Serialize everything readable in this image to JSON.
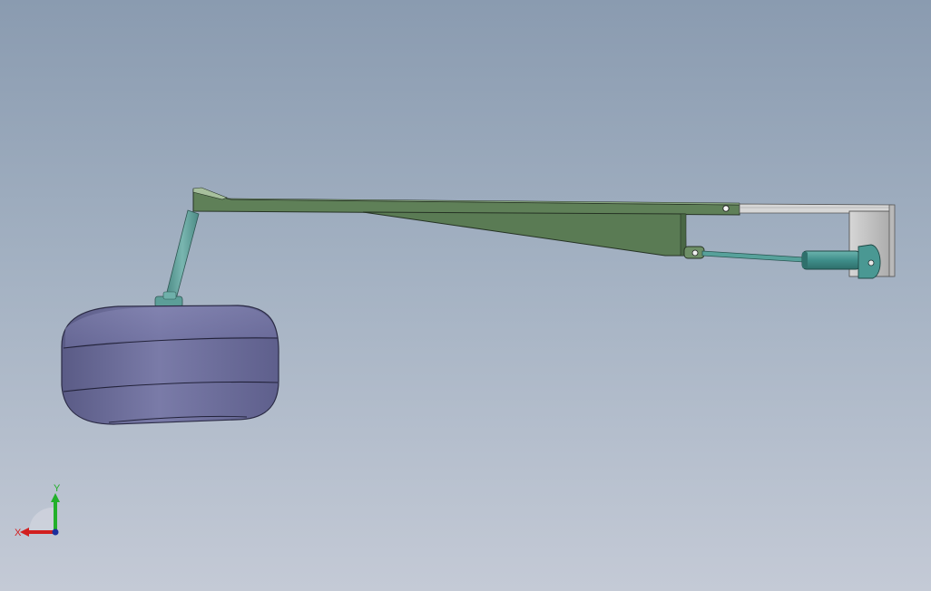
{
  "viewport": {
    "background_top": "#8a9bb0",
    "background_bottom": "#c4cad6"
  },
  "model": {
    "boom_color": "#5e7f5a",
    "boom_edge_color": "#2b3a2a",
    "float_color": "#6e6f9c",
    "rod_color": "#5c9e98",
    "cylinder_color": "#3f8e8a",
    "bracket_color": "#c9c9c9"
  },
  "triad": {
    "x_label": "X",
    "y_label": "Y",
    "x_color": "#d21f1f",
    "y_color": "#22b02a",
    "z_color": "#1b2f9c"
  }
}
